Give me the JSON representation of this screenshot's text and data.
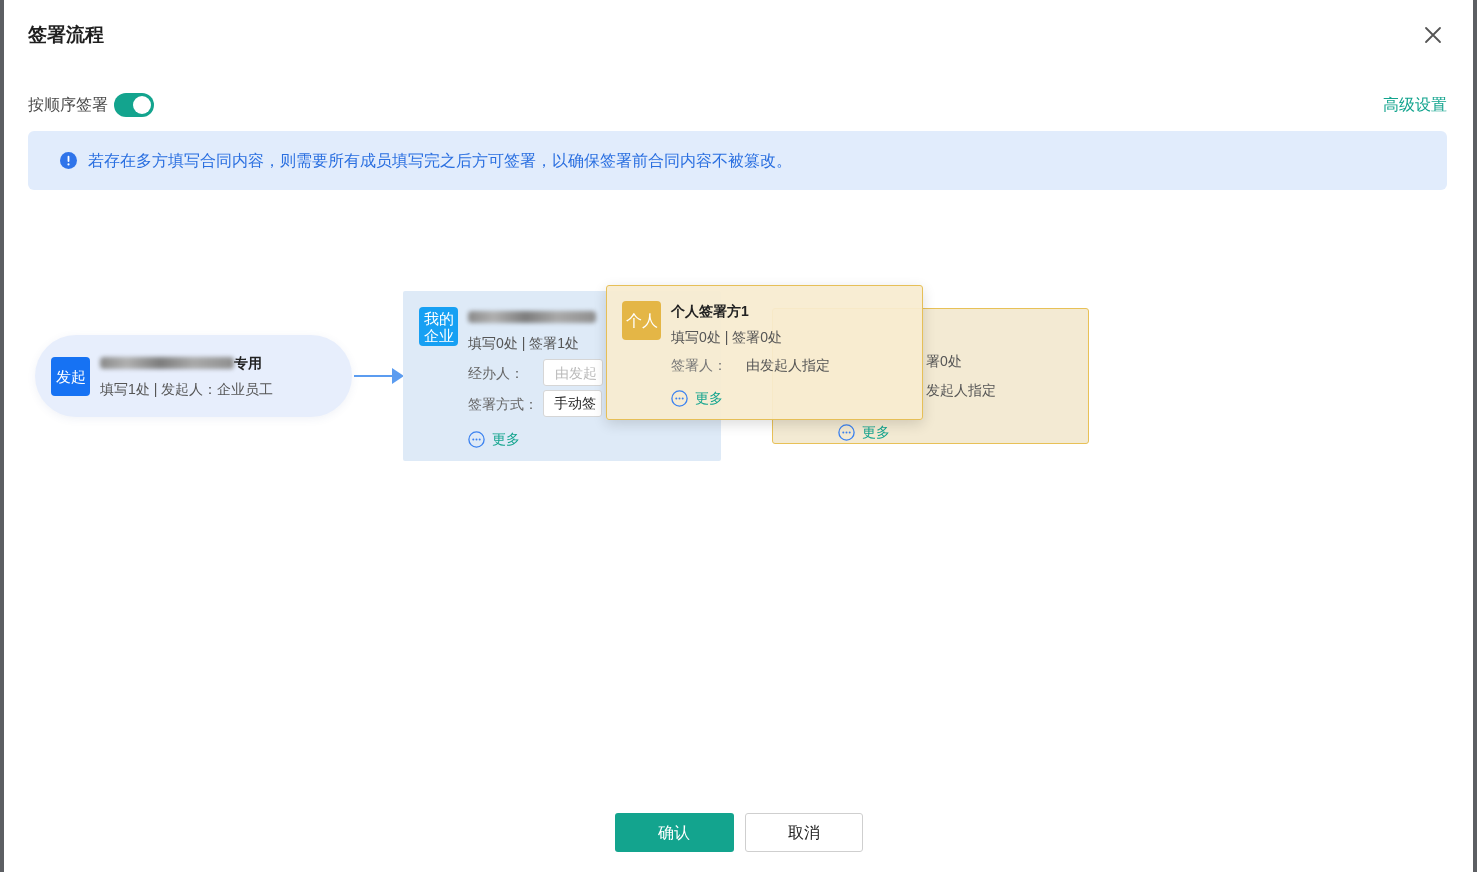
{
  "dialog": {
    "title": "签署流程"
  },
  "sequential_signing": {
    "label": "按顺序签署",
    "on": true
  },
  "advanced_settings": "高级设置",
  "notice": "若存在多方填写合同内容，则需要所有成员填写完之后方可签署，以确保签署前合同内容不被篡改。",
  "flow": {
    "nodes": [
      {
        "kind": "initiator",
        "badge": "发起",
        "title": "专用",
        "stats": "填写1处 | 发起人：企业员工"
      },
      {
        "kind": "company",
        "badge": "我的企业",
        "stats": "填写0处 | 签署1处",
        "fields": [
          {
            "kind": "input",
            "label": "经办人：",
            "placeholder": "由发起"
          },
          {
            "kind": "select",
            "label": "签署方式：",
            "value": "手动签"
          }
        ],
        "more": "更多"
      },
      {
        "kind": "ghost",
        "stats": "署0处",
        "signer": "发起人指定",
        "more": "更多"
      }
    ],
    "dragged_card": {
      "badge": "个人",
      "title": "个人签署方1",
      "stats": "填写0处 | 签署0处",
      "signer_label": "签署人：",
      "signer": "由发起人指定",
      "more": "更多"
    }
  },
  "buttons": [
    {
      "kind": "primary",
      "label": "确认"
    },
    {
      "kind": "secondary",
      "label": "取消"
    }
  ]
}
